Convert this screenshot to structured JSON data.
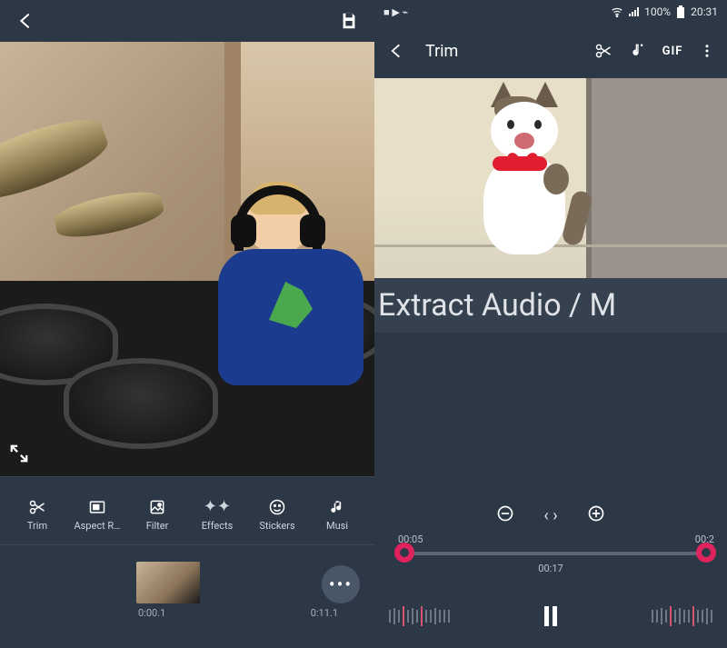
{
  "left": {
    "header": {
      "back": "←",
      "save": "save"
    },
    "expand": "expand",
    "tools": [
      {
        "name": "trim",
        "label": "Trim",
        "icon": "scissors"
      },
      {
        "name": "aspect",
        "label": "Aspect R…",
        "icon": "aspect"
      },
      {
        "name": "filter",
        "label": "Filter",
        "icon": "filter"
      },
      {
        "name": "effects",
        "label": "Effects",
        "icon": "sparkle"
      },
      {
        "name": "stickers",
        "label": "Stickers",
        "icon": "smiley"
      },
      {
        "name": "music",
        "label": "Musi",
        "icon": "note"
      }
    ],
    "timeline": {
      "start": "0:00.1",
      "end": "0:11.1",
      "more": "•••"
    }
  },
  "right": {
    "status": {
      "left_icons": "■ ▶ ⌁",
      "wifi": "wifi",
      "signal": "signal",
      "battery_pct": "100%",
      "time": "20:31",
      "battery_icon": "▮"
    },
    "header": {
      "back": "←",
      "title": "Trim",
      "actions": [
        {
          "name": "trim-tool",
          "icon": "scissors"
        },
        {
          "name": "add-music",
          "icon": "note-plus"
        },
        {
          "name": "gif-export",
          "label": "GIF"
        },
        {
          "name": "overflow",
          "icon": "more-vert"
        }
      ]
    },
    "overlay_text": "Extract Audio / M",
    "zoom": {
      "out": "⊖",
      "fit": "‹ ›",
      "in": "⊕"
    },
    "trim": {
      "start": "00:05",
      "end": "00:2",
      "current": "00:17"
    },
    "playback": {
      "state": "pause"
    }
  }
}
